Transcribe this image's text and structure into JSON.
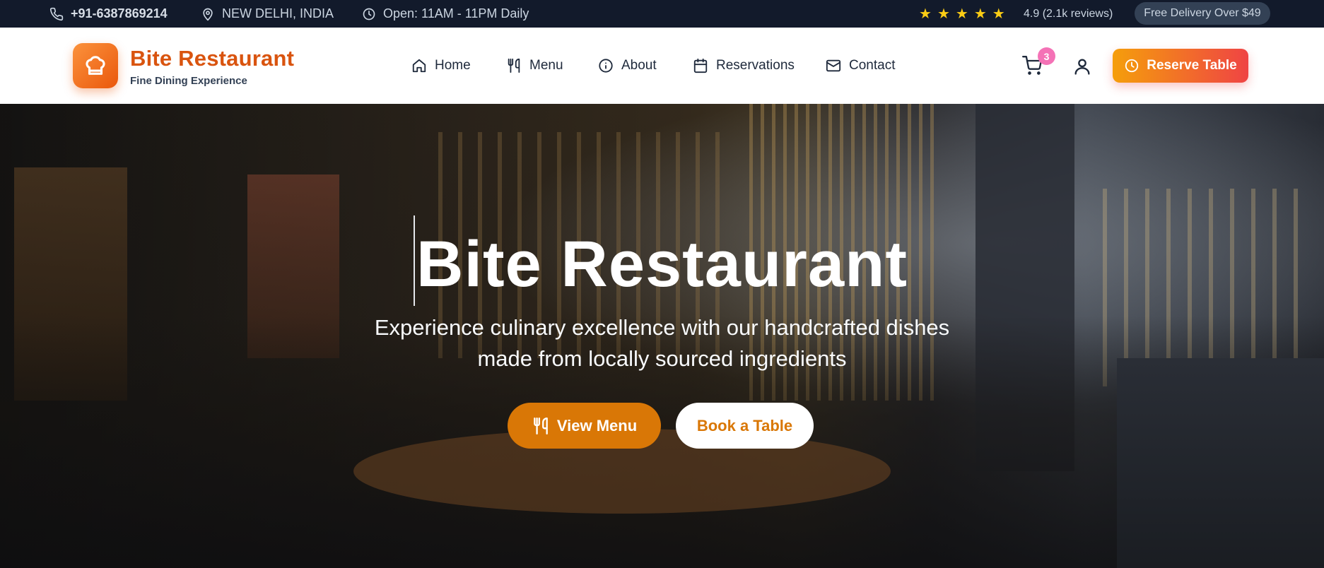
{
  "topbar": {
    "phone": "+91-6387869214",
    "location": "NEW DELHI, INDIA",
    "hours": "Open: 11AM - 11PM Daily",
    "stars": [
      "★",
      "★",
      "★",
      "★",
      "★"
    ],
    "rating": "4.9 (2.1k reviews)",
    "delivery": "Free Delivery Over $49"
  },
  "header": {
    "brand_name": "Bite Restaurant",
    "brand_tagline": "Fine Dining Experience",
    "nav": {
      "home": "Home",
      "menu": "Menu",
      "about": "About",
      "reservations": "Reservations",
      "contact": "Contact"
    },
    "cart_count": "3",
    "reserve_label": "Reserve Table"
  },
  "hero": {
    "title": "Bite Restaurant",
    "subtitle_line1": "Experience culinary excellence with our handcrafted dishes",
    "subtitle_line2": "made from locally sourced ingredients",
    "view_menu_label": "View Menu",
    "book_table_label": "Book a Table"
  },
  "colors": {
    "brand": "#d9540f",
    "accent": "#d97706",
    "topbar_bg": "#121a2b",
    "star": "#facc15"
  },
  "icons": {
    "phone": "phone-icon",
    "location": "map-pin-icon",
    "hours": "clock-icon",
    "logo": "chef-hat-icon",
    "home": "home-icon",
    "menu": "utensils-icon",
    "about": "info-icon",
    "reservations": "calendar-icon",
    "contact": "mail-icon",
    "cart": "cart-icon",
    "user": "user-icon"
  }
}
